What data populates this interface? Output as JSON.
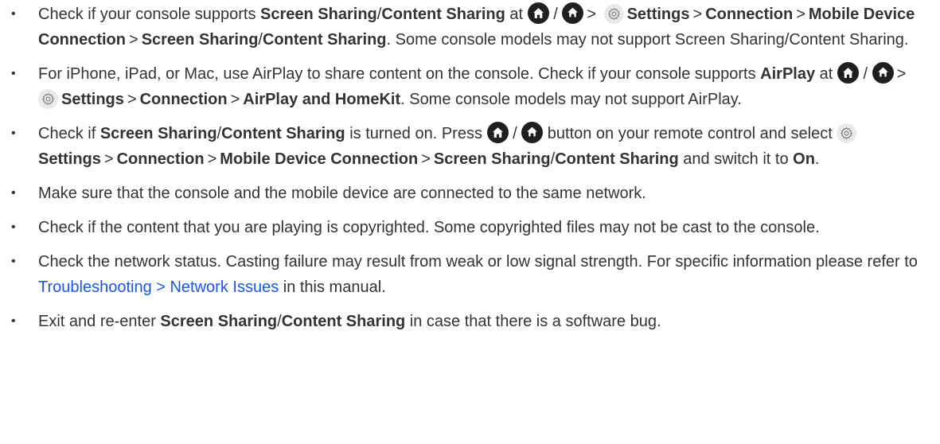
{
  "tips": [
    {
      "p1": "Check if your console supports ",
      "b1": "Screen Sharing",
      "s1": "/",
      "b2": "Content Sharing",
      "p2": " at ",
      "slash": "/",
      "gt1": ">",
      "b3": "Settings",
      "gt2": ">",
      "b4": "Connection",
      "gt3": ">",
      "b5": "Mobile Device Connection",
      "gt4": ">",
      "b6": "Screen Sharing",
      "s2": "/",
      "b7": "Content Sharing",
      "p3": ". Some console models may not support Screen Sharing/Content Sharing."
    },
    {
      "p1": "For iPhone, iPad, or Mac, use AirPlay to share content on the console. Check if your console supports ",
      "b1": "AirPlay",
      "p2": " at ",
      "slash": "/",
      "gt1": ">",
      "b2": "Settings",
      "gt2": ">",
      "b3": "Connection",
      "gt3": ">",
      "b4": "AirPlay and HomeKit",
      "p3": ". Some console models may not support AirPlay."
    },
    {
      "p1": "Check if ",
      "b1": "Screen Sharing",
      "s1": "/",
      "b2": "Content Sharing",
      "p2": " is turned on. Press ",
      "slash": "/",
      "p3": " button on your remote control and select ",
      "b3": "Settings",
      "gt1": ">",
      "b4": "Connection",
      "gt2": ">",
      "b5": "Mobile Device Connection",
      "gt3": ">",
      "b6": "Screen Sharing",
      "s2": "/",
      "b7": "Content Sharing",
      "p4": " and switch it to ",
      "b8": "On",
      "p5": "."
    },
    {
      "text": "Make sure that the console and the mobile device are connected to the same network."
    },
    {
      "text": "Check if the content that you are playing is copyrighted. Some copyrighted files may not be cast to the console."
    },
    {
      "p1": "Check the network status. Casting failure may result from weak or low signal strength. For specific information please refer to ",
      "link": "Troubleshooting > Network Issues",
      "p2": " in this manual."
    },
    {
      "p1": "Exit and re-enter ",
      "b1": "Screen Sharing",
      "s1": "/",
      "b2": "Content Sharing",
      "p2": " in case that there is a software bug."
    }
  ],
  "bullet": "•",
  "icons": {
    "home": "home-icon",
    "settings": "gear-icon"
  },
  "colors": {
    "text": "#333333",
    "link": "#1a56e8",
    "home_icon_bg": "#1f1f1f",
    "gear_icon_bg": "#e9e9e9"
  }
}
